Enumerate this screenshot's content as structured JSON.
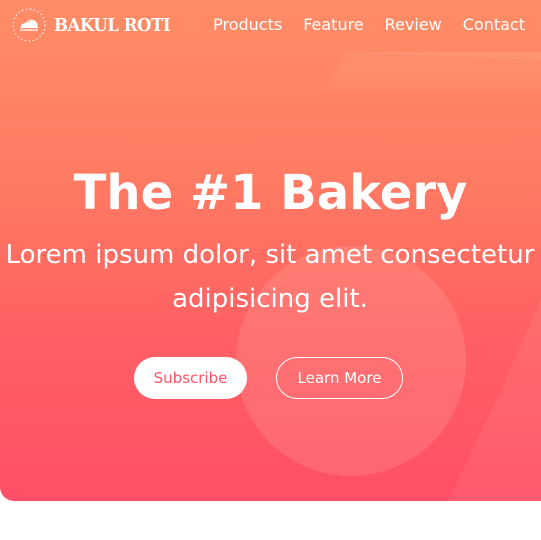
{
  "brand": {
    "name": "BAKUL ROTI"
  },
  "nav": {
    "links": [
      "Products",
      "Feature",
      "Review",
      "Contact"
    ]
  },
  "hero": {
    "title": "The #1 Bakery",
    "subtitle_lines": [
      "Lorem ipsum dolor, sit amet consectetur",
      "adipisicing elit."
    ],
    "subscribe_label": "Subscribe",
    "learn_more_label": "Learn More"
  },
  "colors": {
    "gradient_top": "#ff8d67",
    "gradient_bottom": "#ff4f66",
    "accent": "#ff5465",
    "text": "#ffffff",
    "background": "#ffffff"
  },
  "icons": {
    "logo": "bread-slice-icon"
  }
}
